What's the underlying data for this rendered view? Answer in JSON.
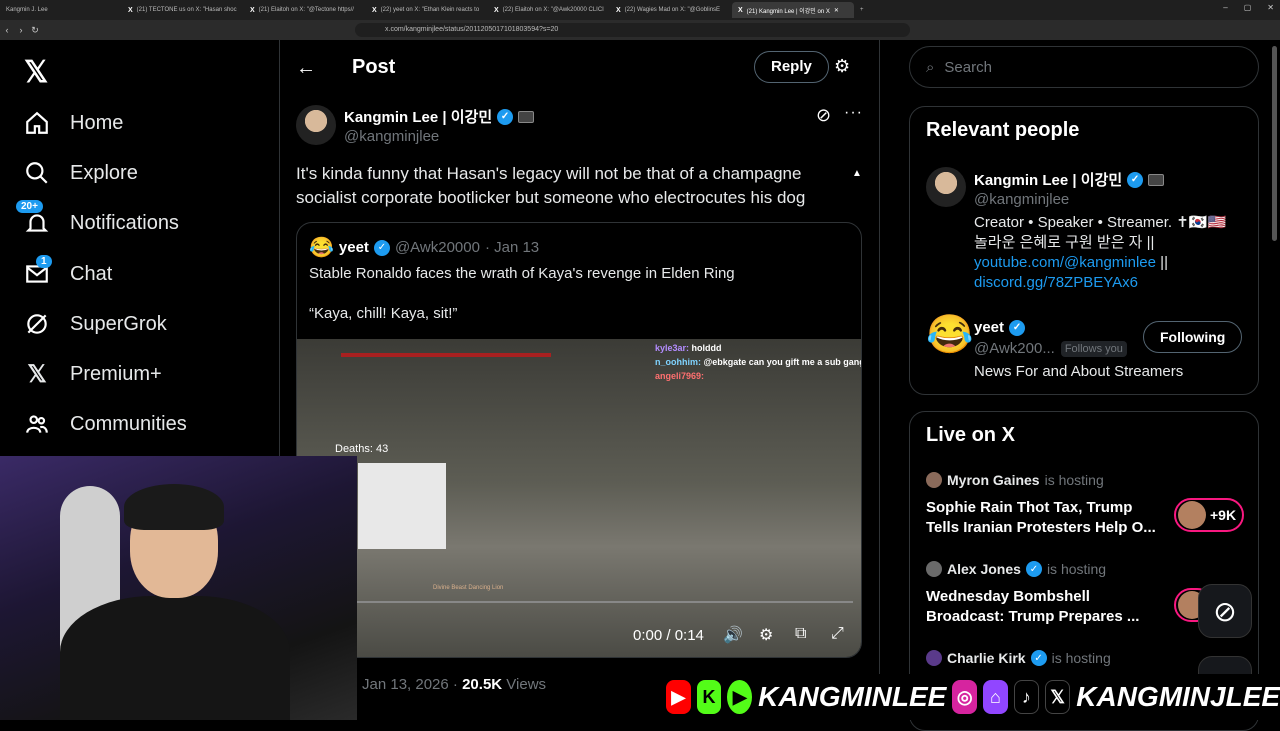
{
  "browser": {
    "tabs": [
      {
        "label": "Kangmin J. Lee"
      },
      {
        "label": "(21) TECTONE us on X: \"Hasan shoc"
      },
      {
        "label": "(21) Elaitoh on X: \"@Tectone https//"
      },
      {
        "label": "(22) yeet on X: \"Ethan Klein reacts to"
      },
      {
        "label": "(22) Elaitoh on X: \"@Awk20000 CLICI"
      },
      {
        "label": "(22) Wagies Mad on X: \"@GoblinsE"
      },
      {
        "label": "(21) Kangmin Lee | 이강민 on X"
      }
    ],
    "url": "x.com/kangminjlee/status/2011205017101803594?s=20"
  },
  "nav": {
    "logo": "𝕏",
    "items": [
      {
        "label": "Home",
        "icon": "home-icon"
      },
      {
        "label": "Explore",
        "icon": "search-icon"
      },
      {
        "label": "Notifications",
        "icon": "bell-icon",
        "badge": "20+"
      },
      {
        "label": "Chat",
        "icon": "mail-icon",
        "badge": "1"
      },
      {
        "label": "SuperGrok",
        "icon": "grok-icon"
      },
      {
        "label": "Premium+",
        "icon": "x-icon"
      },
      {
        "label": "Communities",
        "icon": "people-icon"
      }
    ]
  },
  "post": {
    "header_title": "Post",
    "reply_label": "Reply",
    "author_name": "Kangmin Lee | 이강민",
    "author_handle": "@kangminjlee",
    "text": "It's kinda funny that Hasan's legacy will not be that of a champagne socialist corporate bootlicker but someone who electrocutes his dog",
    "date": "Jan 13, 2026",
    "views_count": "20.5K",
    "views_label": "Views"
  },
  "quote": {
    "emoji": "😂",
    "name": "yeet",
    "handle": "@Awk20000",
    "date": "· Jan 13",
    "line1": "Stable Ronaldo faces the wrath of Kaya's revenge in Elden Ring",
    "line2": "“Kaya, chill! Kaya, sit!”",
    "video": {
      "chat": [
        {
          "user": "kyle3ar:",
          "msg": " holddd"
        },
        {
          "user": "n_oohhim:",
          "msg": " @ebkgate can you gift me a sub gang"
        },
        {
          "user": "angeli7969:",
          "msg": ""
        }
      ],
      "deaths": "Deaths: 43",
      "boss": "Divine Beast Dancing Lion",
      "time": "0:00 / 0:14"
    }
  },
  "search": {
    "placeholder": "Search"
  },
  "relevant": {
    "title": "Relevant people",
    "person1": {
      "name": "Kangmin Lee | 이강민",
      "handle": "@kangminjlee",
      "bio1": "Creator • Speaker • Streamer. ✝🇰🇷🇺🇸",
      "bio2": "놀라운 은혜로 구원 받은 자 ||",
      "link1": "youtube.com/@kangminlee",
      "sep": " ||",
      "link2": "discord.gg/78ZPBEYAx6"
    },
    "person2": {
      "emoji": "😂",
      "name": "yeet",
      "handle": "@Awk200...",
      "follows_you": "Follows you",
      "bio": "News For and About Streamers",
      "following_label": "Following"
    }
  },
  "live": {
    "title": "Live on X",
    "hosting_label": "is hosting",
    "items": [
      {
        "host": "Myron Gaines",
        "title": "Sophie Rain Thot Tax, Trump Tells Iranian Protesters Help O...",
        "count": "+9K"
      },
      {
        "host": "Alex Jones",
        "title": "Wednesday Bombshell Broadcast: Trump Prepares ...",
        "count": ""
      },
      {
        "host": "Charlie Kirk",
        "title": "",
        "count": ""
      }
    ]
  },
  "banner": {
    "name1": "KANGMINLEE",
    "name2": "KANGMINJLEE"
  },
  "colors": {
    "accent": "#1d9bf0",
    "live": "#f91880"
  }
}
